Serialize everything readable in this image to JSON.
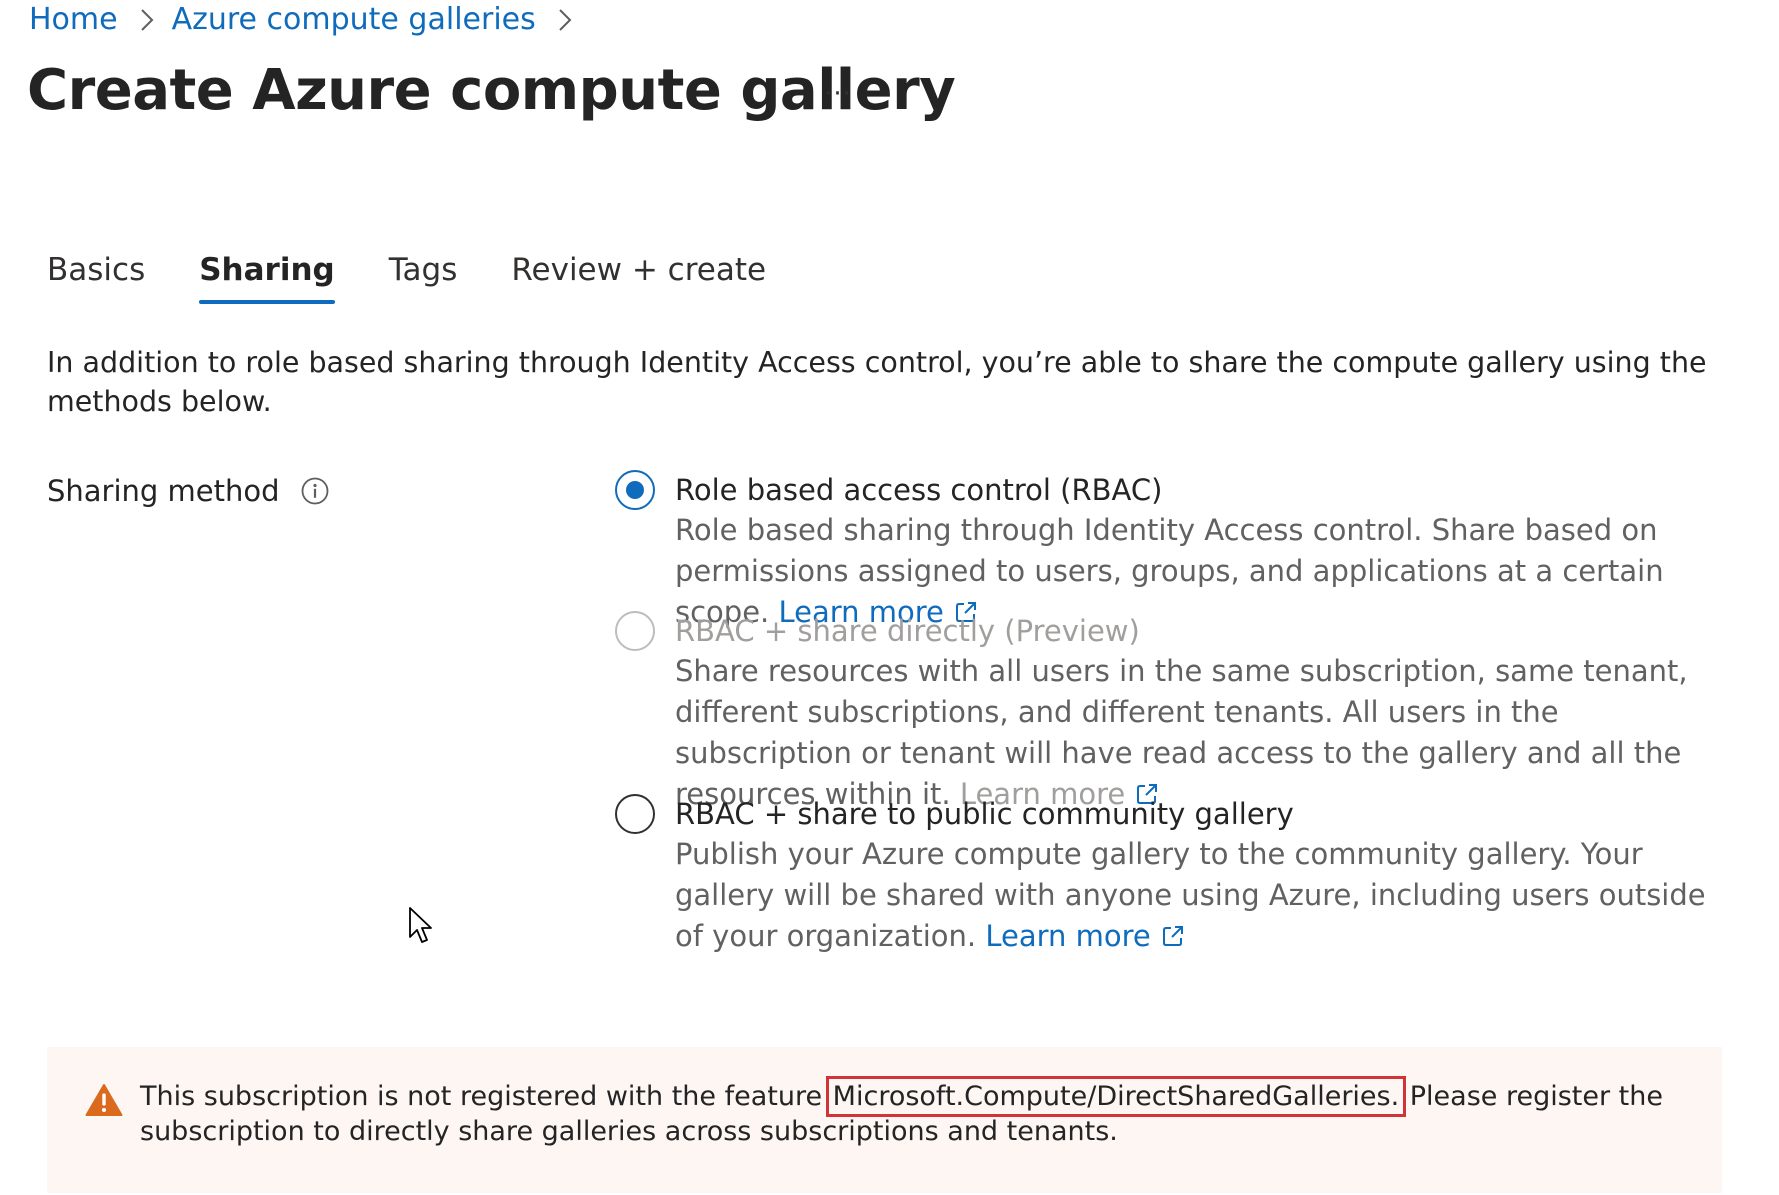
{
  "breadcrumb": {
    "home": "Home",
    "galleries": "Azure compute galleries"
  },
  "page": {
    "title": "Create Azure compute gallery",
    "more": "···"
  },
  "tabs": [
    {
      "label": "Basics",
      "active": false
    },
    {
      "label": "Sharing",
      "active": true
    },
    {
      "label": "Tags",
      "active": false
    },
    {
      "label": "Review + create",
      "active": false
    }
  ],
  "intro": "In addition to role based sharing through Identity Access control, you’re able to share the compute gallery using the methods below.",
  "sharing": {
    "label": "Sharing method",
    "info_icon": "info-icon",
    "selected": "rbac",
    "options": [
      {
        "id": "rbac",
        "title": "Role based access control (RBAC)",
        "description": "Role based sharing through Identity Access control. Share based on permissions assigned to users, groups, and applications at a certain scope.",
        "learn_more": "Learn more",
        "checked": true,
        "disabled": false
      },
      {
        "id": "rbac-direct",
        "title": "RBAC + share directly (Preview)",
        "description": "Share resources with all users in the same subscription, same tenant, different subscriptions, and different tenants. All users in the subscription or tenant will have read access to the gallery and all the resources within it.",
        "learn_more": "Learn more",
        "checked": false,
        "disabled": true
      },
      {
        "id": "rbac-community",
        "title": "RBAC + share to public community gallery",
        "description": "Publish your Azure compute gallery to the community gallery. Your gallery will be shared with anyone using Azure, including users outside of your organization.",
        "learn_more": "Learn more",
        "checked": false,
        "disabled": false
      }
    ]
  },
  "warning": {
    "icon": "warning-icon",
    "text_before": "This subscription is not registered with the feature ",
    "feature": "Microsoft.Compute/DirectSharedGalleries.",
    "text_after": " Please register the subscription to directly share galleries across subscriptions and tenants."
  },
  "colors": {
    "link": "#0f6cbd",
    "warning_bg": "#fdf6f3",
    "warning_icon": "#da6b1e",
    "highlight_box": "#d13438"
  }
}
